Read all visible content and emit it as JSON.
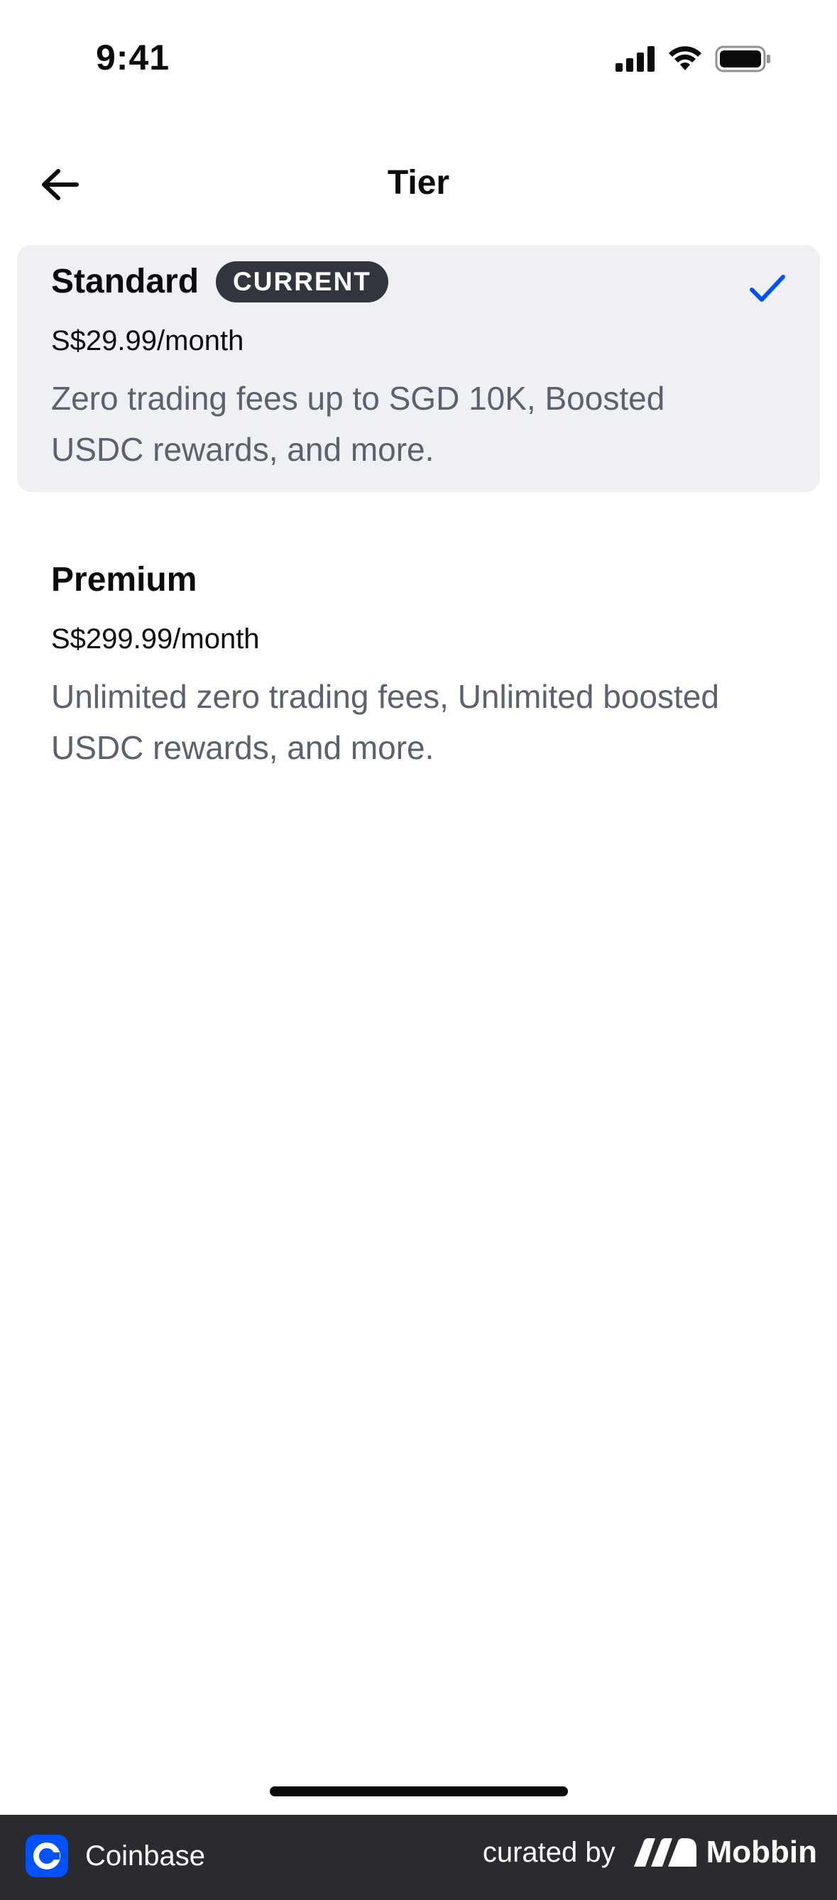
{
  "status_bar": {
    "time": "9:41"
  },
  "header": {
    "title": "Tier",
    "back_icon": "arrow-left-icon"
  },
  "tiers": [
    {
      "name": "Standard",
      "badge": "CURRENT",
      "price": "S$29.99/month",
      "description": "Zero trading fees up to SGD 10K, Boosted USDC rewards, and more.",
      "selected": true
    },
    {
      "name": "Premium",
      "price": "S$299.99/month",
      "description": "Unlimited zero trading fees, Unlimited boosted USDC rewards, and more.",
      "selected": false
    }
  ],
  "footer": {
    "app_name": "Coinbase",
    "curated_by": "curated by",
    "curator": "Mobbin"
  },
  "colors": {
    "accent": "#0052ff",
    "selected_bg": "#eef0f3",
    "badge_bg": "#32353d",
    "secondary_text": "#5b616e",
    "footer_bg": "#2a2b2f"
  }
}
